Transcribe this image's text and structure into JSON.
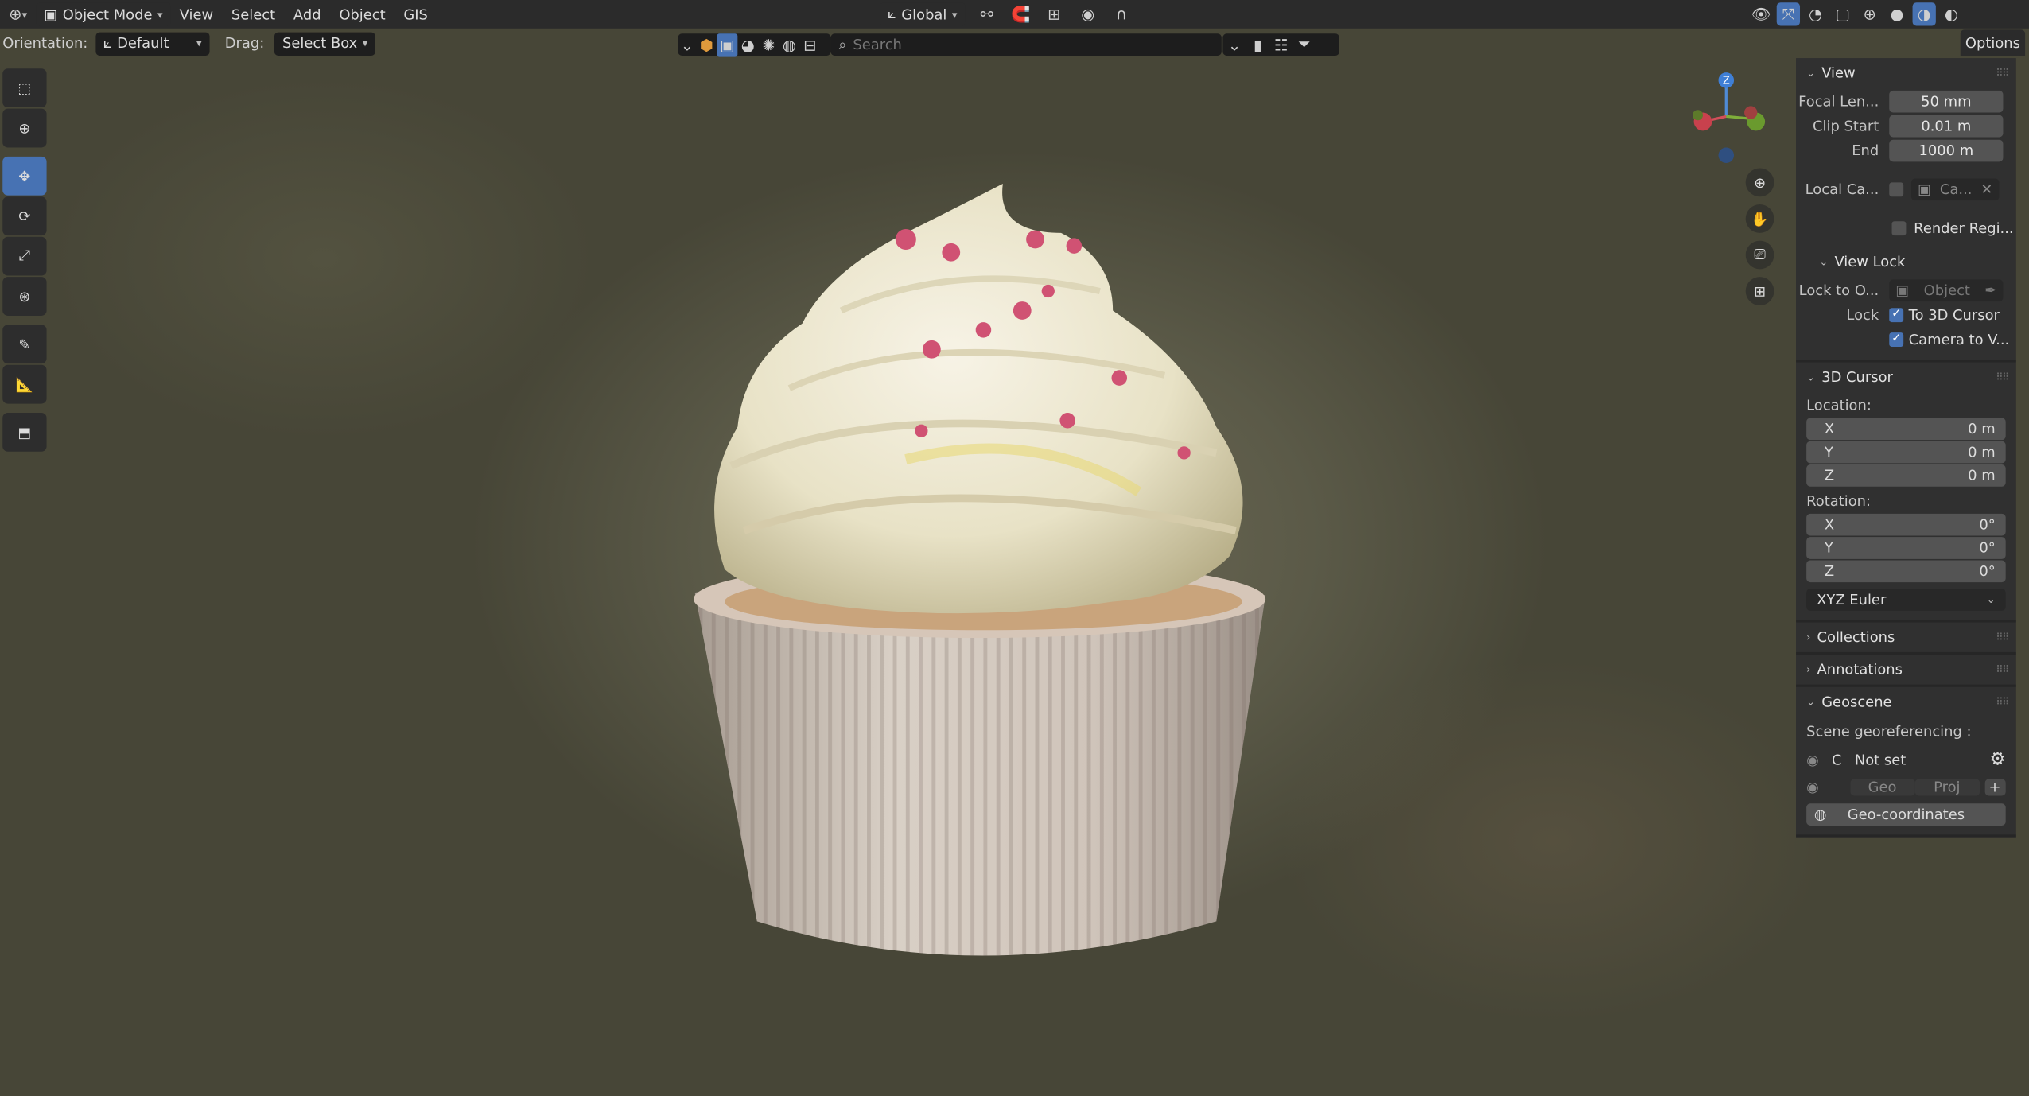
{
  "header": {
    "mode": "Object Mode",
    "menus": [
      "View",
      "Select",
      "Add",
      "Object",
      "GIS"
    ],
    "transform_orientation": "Global"
  },
  "toolheader": {
    "orientation_label": "Orientation:",
    "orientation_value": "Default",
    "drag_label": "Drag:",
    "drag_value": "Select Box"
  },
  "outliner_search": {
    "placeholder": "Search"
  },
  "options_tab": "Options",
  "gizmo": {
    "z_label": "Z"
  },
  "panel": {
    "view": {
      "title": "View",
      "focal_label": "Focal Len...",
      "focal_value": "50 mm",
      "clip_start_label": "Clip Start",
      "clip_start_value": "0.01 m",
      "end_label": "End",
      "end_value": "1000 m",
      "local_camera_label": "Local Ca...",
      "local_camera_value": "Ca...",
      "render_region_label": "Render Regi..."
    },
    "view_lock": {
      "title": "View Lock",
      "lock_to_label": "Lock to O...",
      "lock_to_placeholder": "Object",
      "lock_label": "Lock",
      "to_3d_cursor": "To 3D Cursor",
      "camera_to_view": "Camera to V..."
    },
    "cursor": {
      "title": "3D Cursor",
      "location_label": "Location:",
      "loc": [
        {
          "axis": "X",
          "value": "0 m"
        },
        {
          "axis": "Y",
          "value": "0 m"
        },
        {
          "axis": "Z",
          "value": "0 m"
        }
      ],
      "rotation_label": "Rotation:",
      "rot": [
        {
          "axis": "X",
          "value": "0°"
        },
        {
          "axis": "Y",
          "value": "0°"
        },
        {
          "axis": "Z",
          "value": "0°"
        }
      ],
      "rotation_mode": "XYZ Euler"
    },
    "collections": {
      "title": "Collections"
    },
    "annotations": {
      "title": "Annotations"
    },
    "geoscene": {
      "title": "Geoscene",
      "georef_label": "Scene georeferencing :",
      "crs_letter": "C",
      "not_set": "Not set",
      "geo_btn": "Geo",
      "proj_btn": "Proj",
      "geo_coordinates": "Geo-coordinates"
    }
  }
}
